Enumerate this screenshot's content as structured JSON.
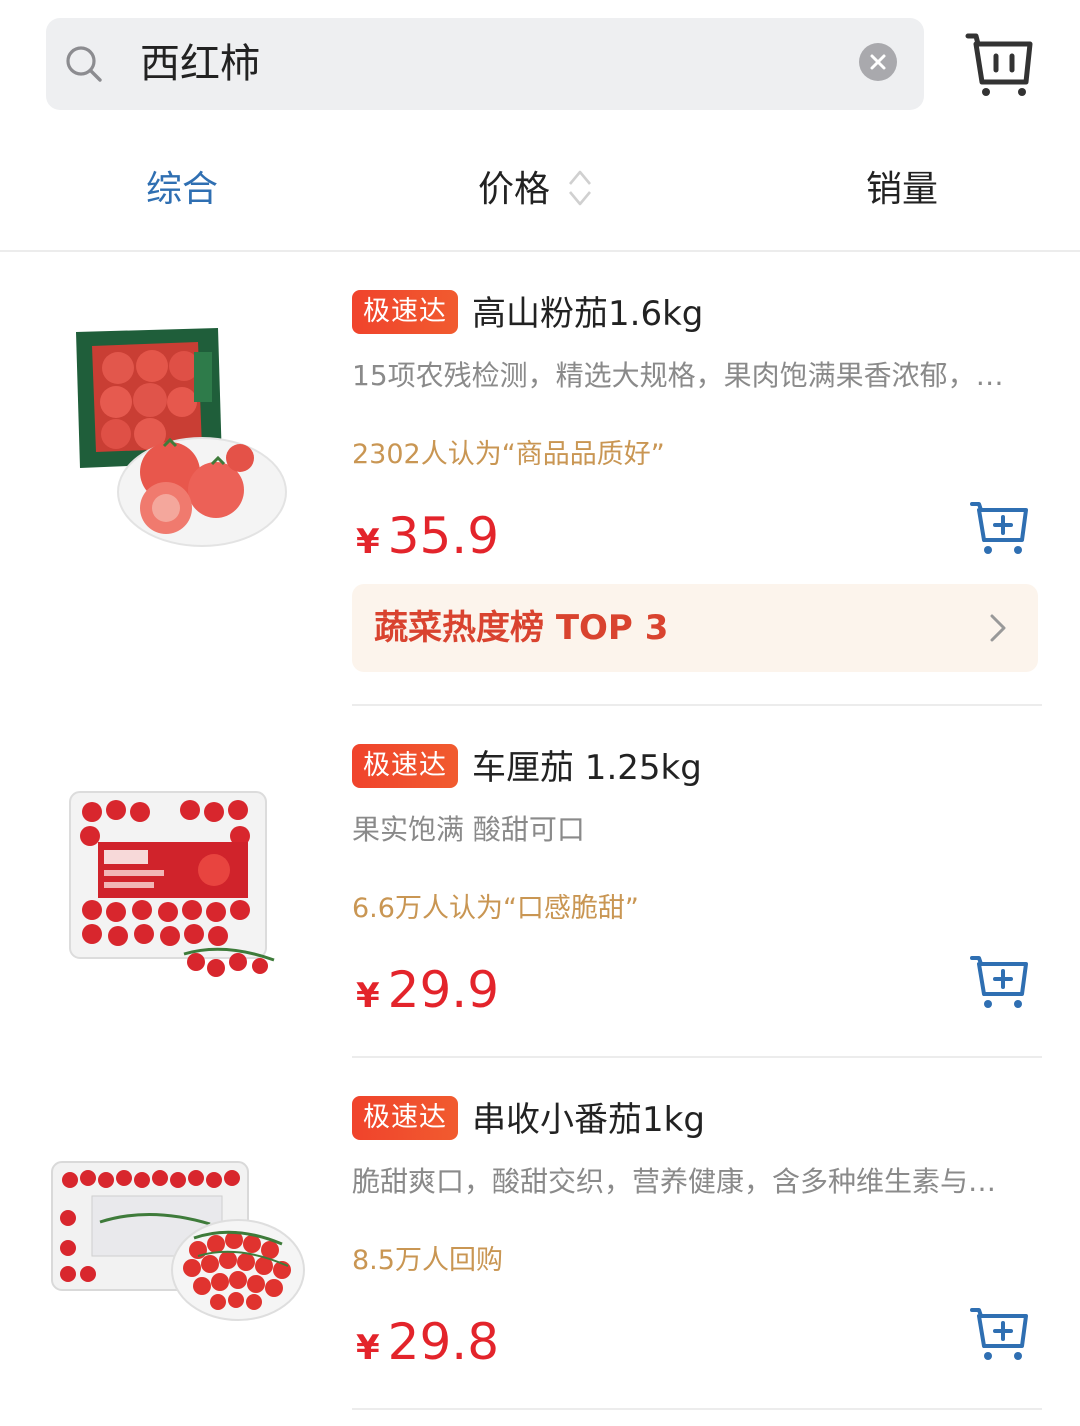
{
  "search": {
    "query": "西红柿"
  },
  "sort_tabs": [
    {
      "label": "综合",
      "active": true
    },
    {
      "label": "价格",
      "active": false
    },
    {
      "label": "销量",
      "active": false
    }
  ],
  "colors": {
    "accent_blue": "#2f6fb2",
    "price_red": "#e3242b",
    "badge_red": "#f0432c",
    "review_gold": "#c99653",
    "rank_bg": "#fcf4ec"
  },
  "products": [
    {
      "badge": "极速达",
      "title": "高山粉茄1.6kg",
      "desc": "15项农残检测，精选大规格，果肉饱满果香浓郁，…",
      "review": "2302人认为“商品品质好”",
      "currency": "¥",
      "price": "35.9",
      "rank_banner": "蔬菜热度榜 TOP 3"
    },
    {
      "badge": "极速达",
      "title": "车厘茄 1.25kg",
      "desc": "果实饱满 酸甜可口",
      "review": "6.6万人认为“口感脆甜”",
      "currency": "¥",
      "price": "29.9"
    },
    {
      "badge": "极速达",
      "title": "串收小番茄1kg",
      "desc": "脆甜爽口，酸甜交织，营养健康，含多种维生素与…",
      "review": "8.5万人回购",
      "currency": "¥",
      "price": "29.8"
    }
  ]
}
